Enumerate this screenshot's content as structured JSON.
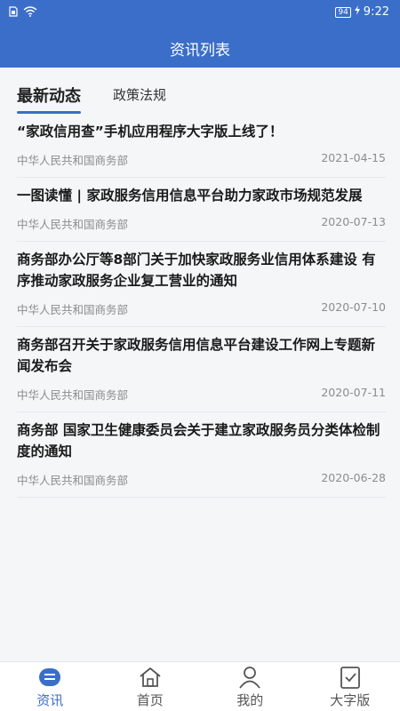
{
  "status": {
    "battery": "94",
    "time": "9:22"
  },
  "header": {
    "title": "资讯列表"
  },
  "tabs": [
    {
      "label": "最新动态",
      "active": true
    },
    {
      "label": "政策法规",
      "active": false
    }
  ],
  "news": [
    {
      "title": "“家政信用查”手机应用程序大字版上线了！",
      "source": "中华人民共和国商务部",
      "date": "2021-04-15"
    },
    {
      "title": "一图读懂 | 家政服务信用信息平台助力家政市场规范发展",
      "source": "中华人民共和国商务部",
      "date": "2020-07-13"
    },
    {
      "title": "商务部办公厅等8部门关于加快家政服务业信用体系建设 有序推动家政服务企业复工营业的通知",
      "source": "中华人民共和国商务部",
      "date": "2020-07-10"
    },
    {
      "title": "商务部召开关于家政服务信用信息平台建设工作网上专题新闻发布会",
      "source": "中华人民共和国商务部",
      "date": "2020-07-11"
    },
    {
      "title": "商务部 国家卫生健康委员会关于建立家政服务员分类体检制度的通知",
      "source": "中华人民共和国商务部",
      "date": "2020-06-28"
    }
  ],
  "nav": [
    {
      "label": "资讯",
      "icon": "news-icon",
      "active": true
    },
    {
      "label": "首页",
      "icon": "home-icon",
      "active": false
    },
    {
      "label": "我的",
      "icon": "user-icon",
      "active": false
    },
    {
      "label": "大字版",
      "icon": "large-font-icon",
      "active": false
    }
  ],
  "colors": {
    "primary": "#3b6ec8",
    "background": "#f5f6f8"
  }
}
